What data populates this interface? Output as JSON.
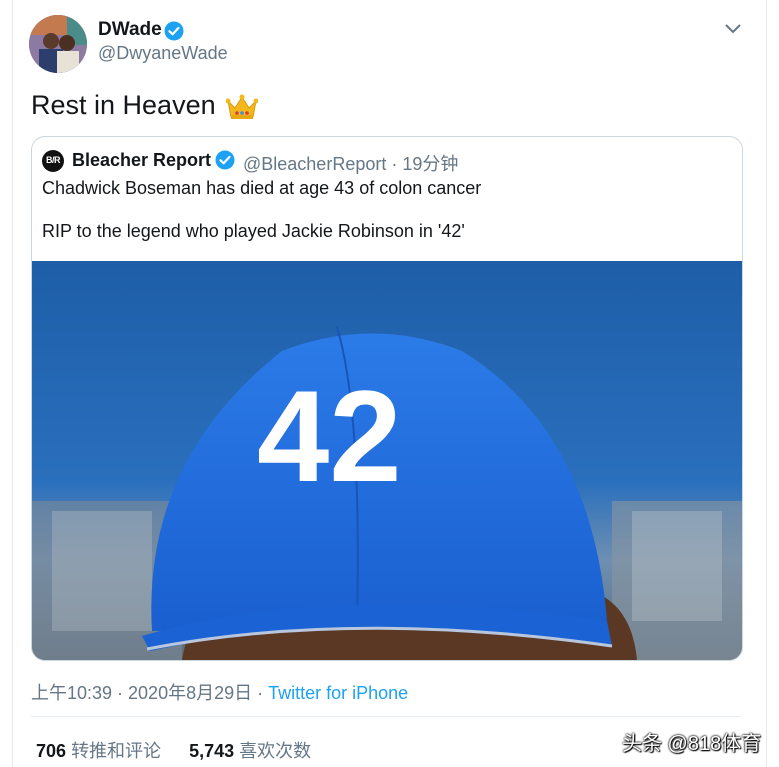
{
  "tweet": {
    "author_name": "DWade",
    "author_handle": "@DwyaneWade",
    "text": "Rest in Heaven",
    "emoji": "crown",
    "timestamp": "上午10:39 · 2020年8月29日",
    "separator": " · ",
    "source": "Twitter for iPhone"
  },
  "quoted": {
    "logo_text": "B/R",
    "author_name": "Bleacher Report",
    "author_handle": "@BleacherReport · 19分钟",
    "line1": "Chadwick Boseman has died at age 43 of colon cancer",
    "line2": "RIP to the legend who played Jackie Robinson in '42'",
    "photo_label": "42"
  },
  "stats": {
    "retweets_count": "706",
    "retweets_label": "转推和评论",
    "likes_count": "5,743",
    "likes_label": "喜欢次数"
  },
  "watermark": "头条 @818体育",
  "colors": {
    "accent": "#1da1f2",
    "muted": "#657786",
    "text": "#14171a",
    "cap_blue": "#1f6fe0"
  },
  "icons": [
    "verified-badge-icon",
    "chevron-down-icon",
    "crown-emoji-icon"
  ]
}
